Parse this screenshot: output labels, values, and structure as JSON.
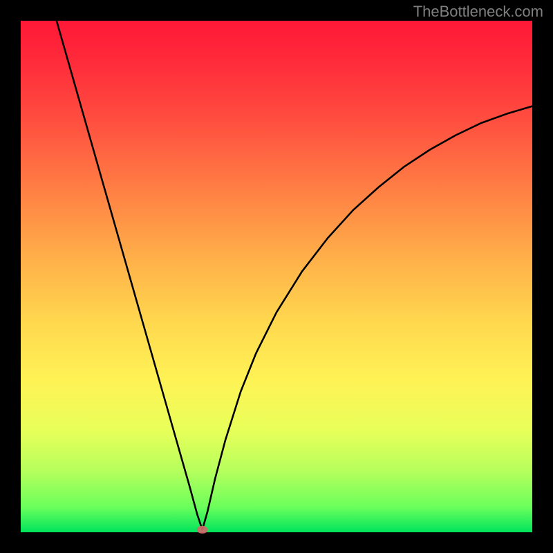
{
  "watermark": "TheBottleneck.com",
  "chart_data": {
    "type": "line",
    "title": "",
    "xlabel": "",
    "ylabel": "",
    "xlim": [
      0,
      1
    ],
    "ylim": [
      0,
      1
    ],
    "notes": "Bottleneck curve: sharp V-shaped minimum near x≈0.355 (y≈0), left branch rises steeply to y≈1 at x≈0.07, right branch rises with decreasing slope to y≈0.83 at x=1. Background is a vertical rainbow gradient (red→orange→yellow→green).",
    "colors": {
      "gradient_stops": [
        "#ff1837",
        "#ff2b3a",
        "#ff5040",
        "#ff7f44",
        "#ffae49",
        "#ffd84e",
        "#fff255",
        "#e9ff59",
        "#b6ff5c",
        "#6cff5b",
        "#00e45c"
      ],
      "curve": "#000000",
      "marker": "#d06a6a",
      "frame": "#000000"
    },
    "x": [
      0.07,
      0.09,
      0.11,
      0.13,
      0.15,
      0.17,
      0.19,
      0.21,
      0.23,
      0.25,
      0.27,
      0.29,
      0.31,
      0.33,
      0.345,
      0.355,
      0.365,
      0.38,
      0.4,
      0.43,
      0.46,
      0.5,
      0.55,
      0.6,
      0.65,
      0.7,
      0.75,
      0.8,
      0.85,
      0.9,
      0.95,
      1.0
    ],
    "y": [
      1.0,
      0.93,
      0.86,
      0.79,
      0.72,
      0.65,
      0.58,
      0.51,
      0.44,
      0.37,
      0.3,
      0.23,
      0.16,
      0.09,
      0.035,
      0.005,
      0.04,
      0.105,
      0.18,
      0.275,
      0.35,
      0.43,
      0.51,
      0.575,
      0.63,
      0.675,
      0.715,
      0.748,
      0.776,
      0.8,
      0.818,
      0.833
    ],
    "marker": {
      "x": 0.355,
      "y": 0.005
    }
  }
}
